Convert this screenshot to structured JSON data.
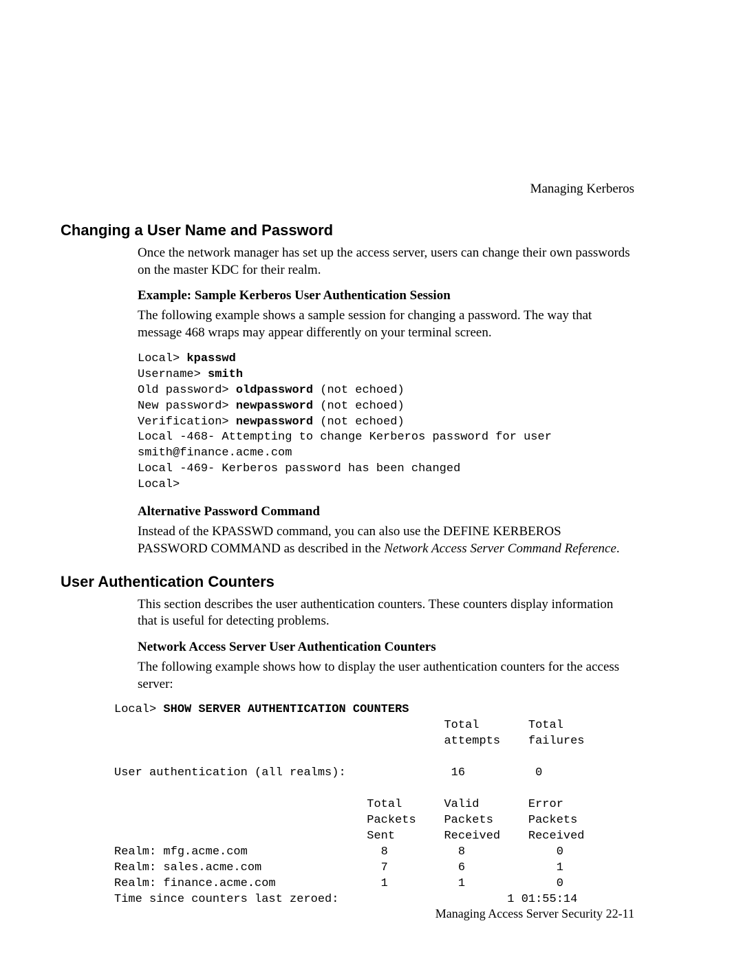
{
  "header": {
    "chapter": "Managing Kerberos"
  },
  "section1": {
    "title": "Changing a User Name and Password",
    "intro": "Once the network manager has set up the access server, users can change their own passwords on the master KDC for their realm.",
    "sub1_title": "Example: Sample Kerberos User Authentication Session",
    "sub1_body": "The following example shows a sample session for changing a password. The way that message 468 wraps may appear differently on your terminal screen.",
    "code": {
      "l1_prompt": "Local> ",
      "l1_cmd": "kpasswd",
      "l2_prompt": "Username> ",
      "l2_val": "smith",
      "l3_prompt": "Old password> ",
      "l3_val": "oldpassword",
      "l3_tail": " (not echoed)",
      "l4_prompt": "New password> ",
      "l4_val": "newpassword",
      "l4_tail": " (not echoed)",
      "l5_prompt": "Verification> ",
      "l5_val": "newpassword",
      "l5_tail": " (not echoed)",
      "l6": "Local -468- Attempting to change Kerberos password for user",
      "l7": "smith@finance.acme.com",
      "l8": "Local -469- Kerberos password has been changed",
      "l9": "Local>"
    },
    "sub2_title": "Alternative Password Command",
    "sub2_body_a": "Instead of the KPASSWD command, you can also use the DEFINE KERBEROS PASSWORD COMMAND as described in the ",
    "sub2_body_ital": "Network Access Server Command Reference",
    "sub2_body_b": "."
  },
  "section2": {
    "title": "User Authentication Counters",
    "intro": "This section describes the user authentication counters. These counters display information that is useful for detecting problems.",
    "sub1_title": "Network Access Server User Authentication Counters",
    "sub1_body": "The following example shows how to display the user authentication counters for the access server:",
    "code": {
      "prompt": "Local> ",
      "cmd": "SHOW SERVER AUTHENTICATION COUNTERS",
      "hdr1a": "                                               Total       Total",
      "hdr1b": "                                               attempts    failures",
      "blank": "",
      "row_all": "User authentication (all realms):               16          0",
      "hdr2a": "                                    Total      Valid       Error",
      "hdr2b": "                                    Packets    Packets     Packets",
      "hdr2c": "                                    Sent       Received    Received",
      "row_r1": "Realm: mfg.acme.com                   8          8             0",
      "row_r2": "Realm: sales.acme.com                 7          6             1",
      "row_r3": "Realm: finance.acme.com               1          1             0",
      "row_t": "Time since counters last zeroed:                        1 01:55:14"
    }
  },
  "footer": {
    "text": "Managing Access Server Security 22-11"
  },
  "chart_data": {
    "type": "table",
    "title": "SHOW SERVER AUTHENTICATION COUNTERS",
    "summary": {
      "columns": [
        "Total attempts",
        "Total failures"
      ],
      "rows": [
        {
          "label": "User authentication (all realms)",
          "values": [
            16,
            0
          ]
        }
      ]
    },
    "realms": {
      "columns": [
        "Total Packets Sent",
        "Valid Packets Received",
        "Error Packets Received"
      ],
      "rows": [
        {
          "label": "Realm: mfg.acme.com",
          "values": [
            8,
            8,
            0
          ]
        },
        {
          "label": "Realm: sales.acme.com",
          "values": [
            7,
            6,
            1
          ]
        },
        {
          "label": "Realm: finance.acme.com",
          "values": [
            1,
            1,
            0
          ]
        }
      ]
    },
    "time_since_zeroed": "1 01:55:14"
  }
}
